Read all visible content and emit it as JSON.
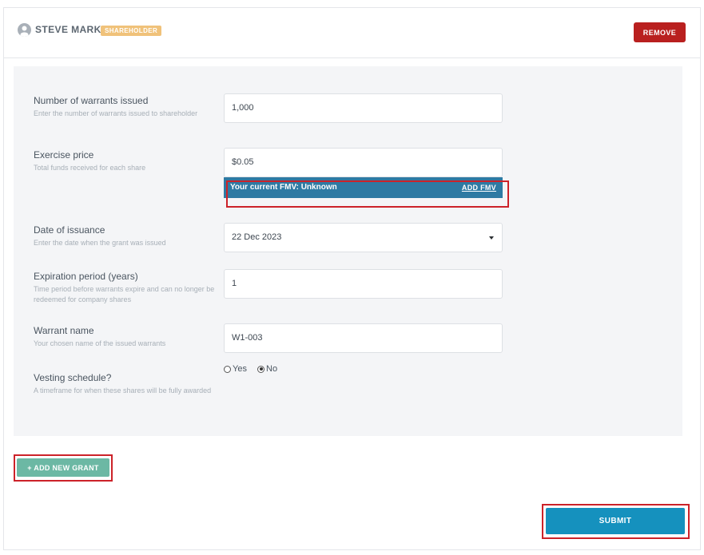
{
  "shareholder": {
    "name": "STEVE MARK",
    "role_badge": "SHAREHOLDER",
    "remove_label": "REMOVE"
  },
  "form": {
    "warrants": {
      "label": "Number of warrants issued",
      "help": "Enter the number of warrants issued to shareholder",
      "value": "1,000"
    },
    "exercise_price": {
      "label": "Exercise price",
      "help": "Total funds received for each share",
      "value": "$0.05"
    },
    "fmv": {
      "text": "Your current FMV: Unknown",
      "action": "ADD FMV"
    },
    "date_of_issuance": {
      "label": "Date of issuance",
      "help": "Enter the date when the grant was issued",
      "value": "22 Dec 2023"
    },
    "expiration": {
      "label": "Expiration period (years)",
      "help": "Time period before warrants expire and can no longer be redeemed for company shares",
      "value": "1"
    },
    "warrant_name": {
      "label": "Warrant name",
      "help": "Your chosen name of the issued warrants",
      "value": "W1-003"
    },
    "vesting": {
      "label": "Vesting schedule?",
      "help": "A timeframe for when these shares will be fully awarded",
      "options": [
        "Yes",
        "No"
      ],
      "selected": "No"
    }
  },
  "actions": {
    "add_grant_label": "+ ADD NEW GRANT",
    "submit_label": "SUBMIT"
  },
  "colors": {
    "remove": "#b9201f",
    "badge": "#f0c27a",
    "fmv_bar": "#2e7aa3",
    "add_grant": "#6cb8a4",
    "submit": "#1591be",
    "highlight": "#cc2229"
  },
  "icons": {
    "avatar": "user-icon",
    "dropdown": "caret-down-icon"
  }
}
